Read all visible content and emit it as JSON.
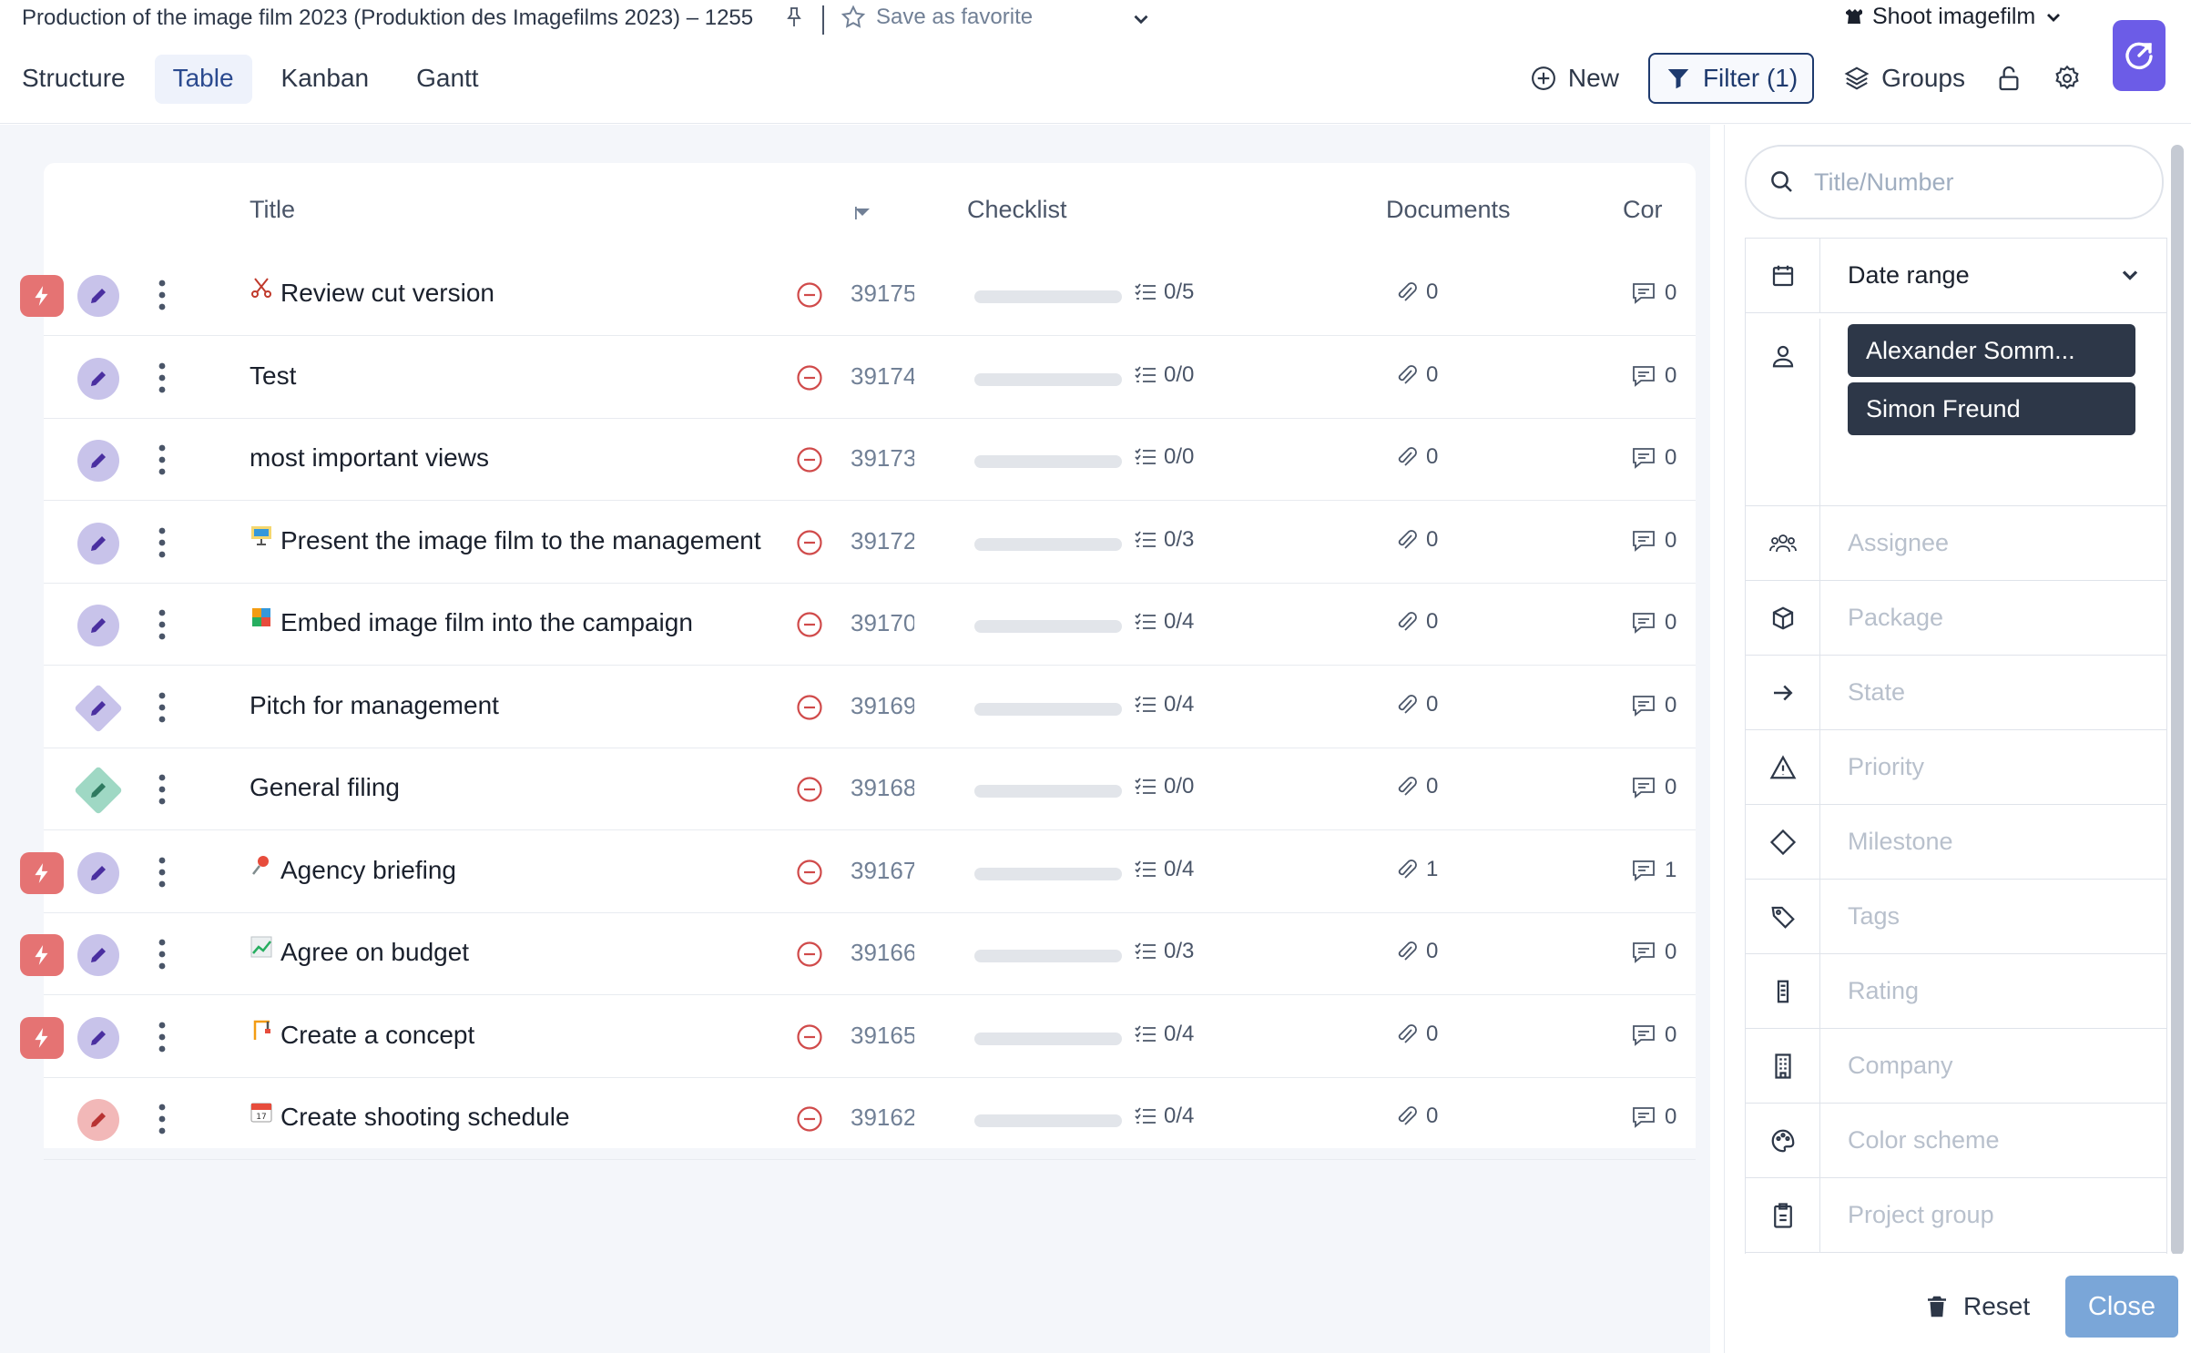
{
  "header": {
    "project_title": "Production of the image film 2023 (Produktion des Imagefilms 2023) – 1255",
    "favorite_label": "Save as favorite",
    "project_switch": "Shoot imagefilm",
    "tabs": [
      {
        "label": "Structure",
        "active": false
      },
      {
        "label": "Table",
        "active": true
      },
      {
        "label": "Kanban",
        "active": false
      },
      {
        "label": "Gantt",
        "active": false
      }
    ],
    "toolbar": {
      "new_label": "New",
      "filter_label": "Filter (1)",
      "groups_label": "Groups"
    }
  },
  "table": {
    "columns": {
      "title": "Title",
      "checklist": "Checklist",
      "documents": "Documents",
      "comments": "Cor"
    },
    "rows": [
      {
        "title": "Review cut version",
        "emoji": "scissors",
        "number": "39175",
        "checklist": "0/5",
        "documents": "0",
        "comments": "0",
        "priority": true,
        "type": "task"
      },
      {
        "title": "Test",
        "emoji": "",
        "number": "39174",
        "checklist": "0/0",
        "documents": "0",
        "comments": "0",
        "priority": false,
        "type": "task"
      },
      {
        "title": "most important views",
        "emoji": "",
        "number": "39173",
        "checklist": "0/0",
        "documents": "0",
        "comments": "0",
        "priority": false,
        "type": "task"
      },
      {
        "title": "Present the image film to the management",
        "emoji": "presentation",
        "number": "39172",
        "checklist": "0/3",
        "documents": "0",
        "comments": "0",
        "priority": false,
        "type": "task"
      },
      {
        "title": "Embed image film into the campaign",
        "emoji": "puzzle",
        "number": "39170",
        "checklist": "0/4",
        "documents": "0",
        "comments": "0",
        "priority": false,
        "type": "task"
      },
      {
        "title": "Pitch for management",
        "emoji": "",
        "number": "39169",
        "checklist": "0/4",
        "documents": "0",
        "comments": "0",
        "priority": false,
        "type": "milestone"
      },
      {
        "title": "General filing",
        "emoji": "",
        "number": "39168",
        "checklist": "0/0",
        "documents": "0",
        "comments": "0",
        "priority": false,
        "type": "milestone-green"
      },
      {
        "title": "Agency briefing",
        "emoji": "pushpin",
        "number": "39167",
        "checklist": "0/4",
        "documents": "1",
        "comments": "1",
        "priority": true,
        "type": "task"
      },
      {
        "title": "Agree on budget",
        "emoji": "chart",
        "number": "39166",
        "checklist": "0/3",
        "documents": "0",
        "comments": "0",
        "priority": true,
        "type": "task"
      },
      {
        "title": "Create a concept",
        "emoji": "crane",
        "number": "39165",
        "checklist": "0/4",
        "documents": "0",
        "comments": "0",
        "priority": true,
        "type": "task"
      },
      {
        "title": "Create shooting schedule",
        "emoji": "calendar",
        "number": "39162",
        "checklist": "0/4",
        "documents": "0",
        "comments": "0",
        "priority": false,
        "type": "task-red"
      }
    ]
  },
  "filter_panel": {
    "search_placeholder": "Title/Number",
    "date_range_label": "Date range",
    "users": [
      "Alexander Somm...",
      "Simon Freund"
    ],
    "fields": [
      {
        "label": "Assignee",
        "icon": "team-icon"
      },
      {
        "label": "Package",
        "icon": "package-icon"
      },
      {
        "label": "State",
        "icon": "arrow-right-icon"
      },
      {
        "label": "Priority",
        "icon": "warning-icon"
      },
      {
        "label": "Milestone",
        "icon": "diamond-icon"
      },
      {
        "label": "Tags",
        "icon": "tags-icon"
      },
      {
        "label": "Rating",
        "icon": "rating-icon"
      },
      {
        "label": "Company",
        "icon": "building-icon"
      },
      {
        "label": "Color scheme",
        "icon": "palette-icon"
      },
      {
        "label": "Project group",
        "icon": "clipboard-icon"
      }
    ],
    "reset_label": "Reset",
    "close_label": "Close"
  },
  "colors": {
    "priority_red": "#e57373",
    "type_purple": "#c8c3ea",
    "type_green": "#9fd8c4",
    "chip_dark": "#2d3748",
    "filter_border": "#1e3a6e",
    "close_button": "#7aa6d8",
    "logo_purple": "#6c5ce7"
  }
}
